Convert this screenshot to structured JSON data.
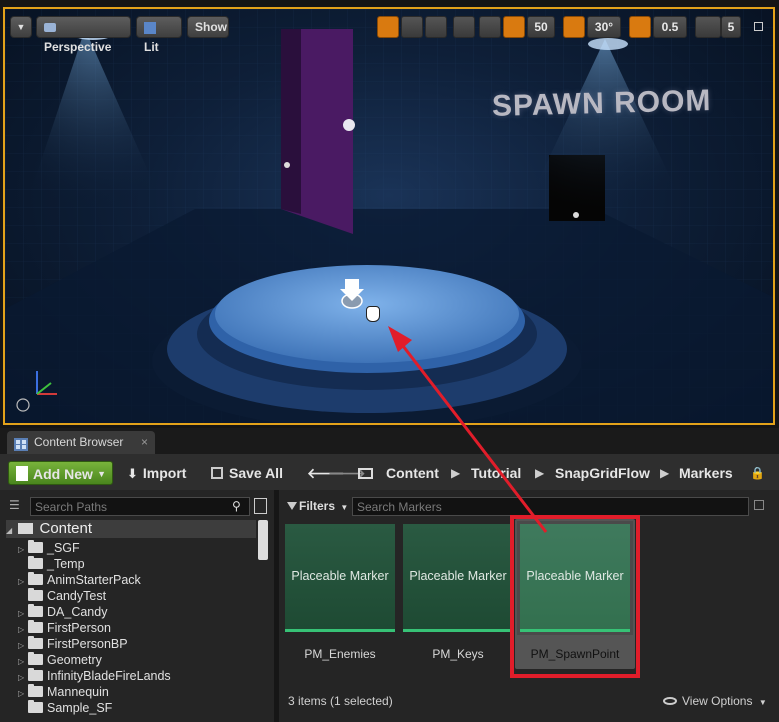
{
  "viewport": {
    "perspective_label": "Perspective",
    "lit_label": "Lit",
    "show_label": "Show",
    "grid_snap_value": "50",
    "rotation_snap_value": "30°",
    "scale_snap_value": "0.5",
    "camera_speed_value": "5",
    "scene_text": "SPAWN ROOM"
  },
  "tab": {
    "label": "Content Browser",
    "close": "×"
  },
  "toolbar": {
    "add_new_label": "Add New",
    "import_label": "Import",
    "save_all_label": "Save All",
    "breadcrumb": [
      "Content",
      "Tutorial",
      "SnapGridFlow",
      "Markers"
    ]
  },
  "left_panel": {
    "search_placeholder": "Search Paths",
    "root_label": "Content",
    "tree": [
      "_SGF",
      "_Temp",
      "AnimStarterPack",
      "CandyTest",
      "DA_Candy",
      "FirstPerson",
      "FirstPersonBP",
      "Geometry",
      "InfinityBladeFireLands",
      "Mannequin",
      "Sample_SF"
    ]
  },
  "right_panel": {
    "filters_label": "Filters",
    "search_placeholder": "Search Markers",
    "assets": [
      {
        "thumb": "Placeable Marker",
        "name": "PM_Enemies"
      },
      {
        "thumb": "Placeable Marker",
        "name": "PM_Keys"
      },
      {
        "thumb": "Placeable Marker",
        "name": "PM_SpawnPoint"
      }
    ],
    "status": "3 items (1 selected)",
    "view_options_label": "View Options"
  },
  "colors": {
    "viewport_border": "#e3a21a",
    "add_new_green": "#5c9a2a",
    "asset_green": "#2a5a42",
    "asset_underline": "#37c276",
    "annotation_red": "#e11d2a"
  }
}
